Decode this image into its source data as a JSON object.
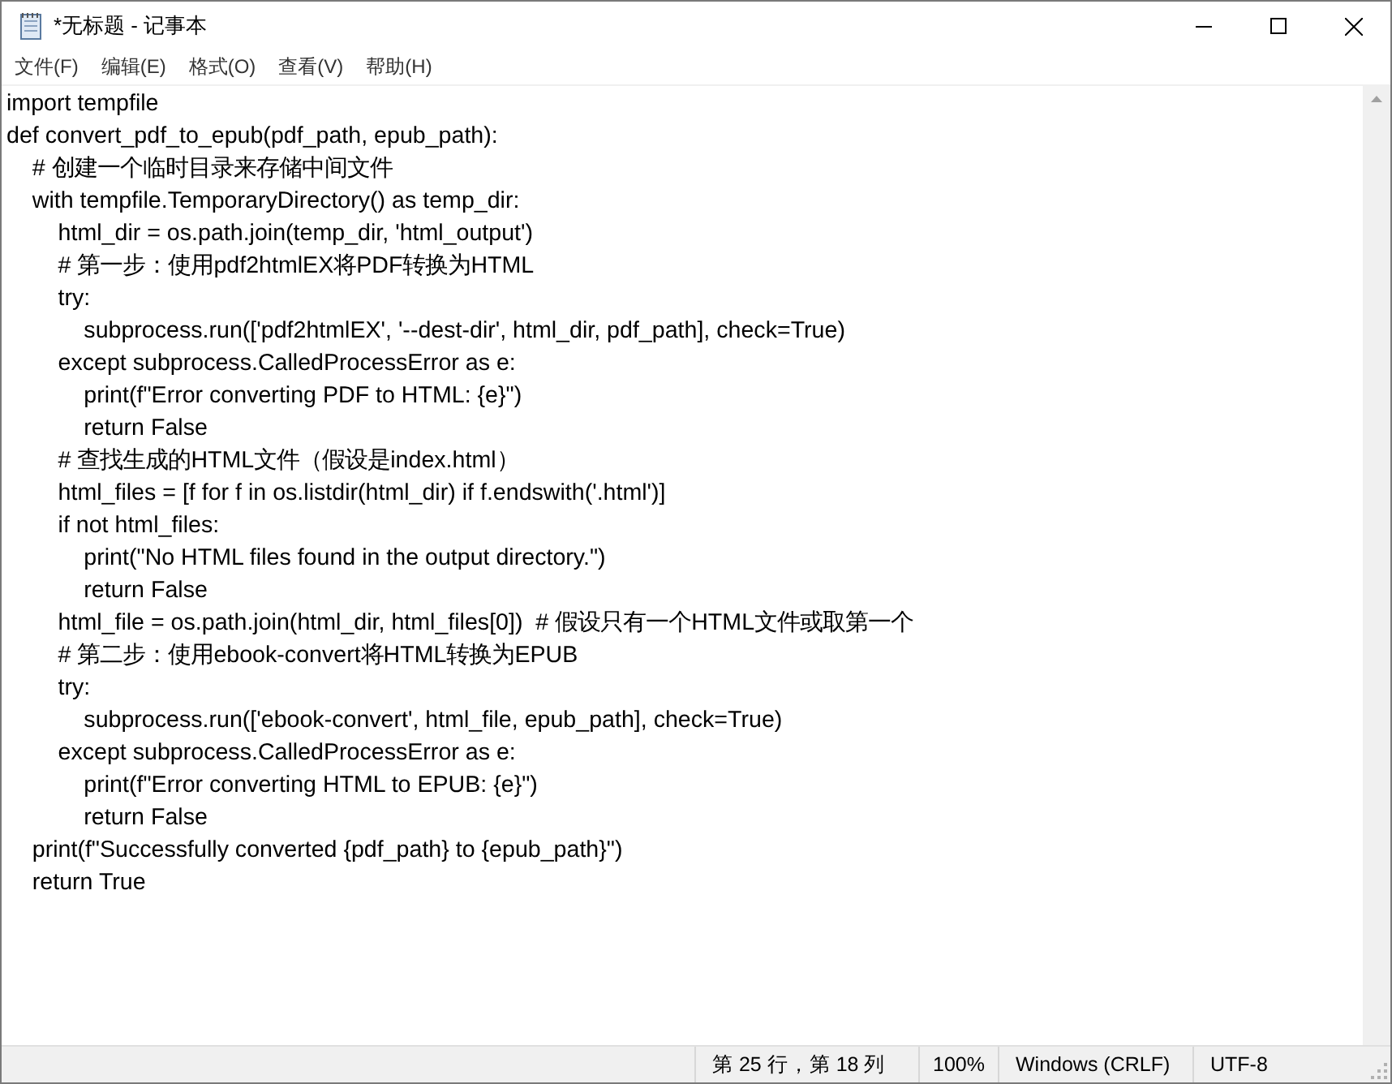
{
  "window": {
    "title": "*无标题 - 记事本"
  },
  "menu": [
    "文件(F)",
    "编辑(E)",
    "格式(O)",
    "查看(V)",
    "帮助(H)"
  ],
  "editor": {
    "lines": [
      "import tempfile",
      "def convert_pdf_to_epub(pdf_path, epub_path):",
      "    # 创建一个临时目录来存储中间文件",
      "    with tempfile.TemporaryDirectory() as temp_dir:",
      "        html_dir = os.path.join(temp_dir, 'html_output')",
      "        # 第一步：使用pdf2htmlEX将PDF转换为HTML",
      "        try:",
      "            subprocess.run(['pdf2htmlEX', '--dest-dir', html_dir, pdf_path], check=True)",
      "        except subprocess.CalledProcessError as e:",
      "            print(f\"Error converting PDF to HTML: {e}\")",
      "            return False",
      "        # 查找生成的HTML文件（假设是index.html）",
      "        html_files = [f for f in os.listdir(html_dir) if f.endswith('.html')]",
      "        if not html_files:",
      "            print(\"No HTML files found in the output directory.\")",
      "            return False",
      "        html_file = os.path.join(html_dir, html_files[0])  # 假设只有一个HTML文件或取第一个",
      "        # 第二步：使用ebook-convert将HTML转换为EPUB",
      "        try:",
      "            subprocess.run(['ebook-convert', html_file, epub_path], check=True)",
      "        except subprocess.CalledProcessError as e:",
      "            print(f\"Error converting HTML to EPUB: {e}\")",
      "            return False",
      "    print(f\"Successfully converted {pdf_path} to {epub_path}\")",
      "    return True"
    ]
  },
  "status_bar": {
    "position": "第 25 行，第 18 列",
    "zoom": "100%",
    "line_ending": "Windows (CRLF)",
    "encoding": "UTF-8"
  }
}
